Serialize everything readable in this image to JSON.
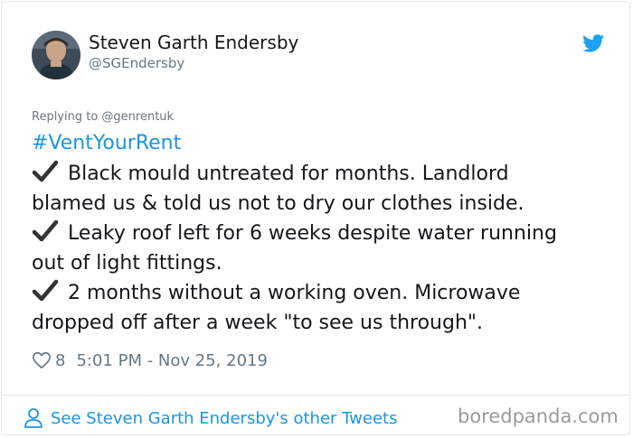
{
  "author": {
    "name": "Steven Garth Endersby",
    "handle": "@SGEndersby",
    "avatar_icon": "person-avatar"
  },
  "tweet": {
    "reply_context": "Replying to @genrentuk",
    "hashtag": "#VentYourRent",
    "lines": [
      "Black mould untreated for months. Landlord",
      "blamed us & told us not to dry our clothes inside.",
      "Leaky roof left for 6 weeks despite water running",
      "out of light fittings.",
      "2 months without a working oven. Microwave",
      "dropped off after a week \"to see us through\"."
    ],
    "likes": "8",
    "timestamp": "5:01 PM - Nov 25, 2019"
  },
  "footer": {
    "link_label": "See Steven Garth Endersby's other Tweets",
    "watermark": "boredpanda.com"
  },
  "colors": {
    "link_blue": "#1b95e0",
    "twitter_blue": "#1da1f2",
    "muted_gray": "#657786",
    "border": "#e1e8ed"
  },
  "icons": [
    "twitter-bird-icon",
    "check-mark-icon",
    "heart-icon",
    "person-icon"
  ]
}
